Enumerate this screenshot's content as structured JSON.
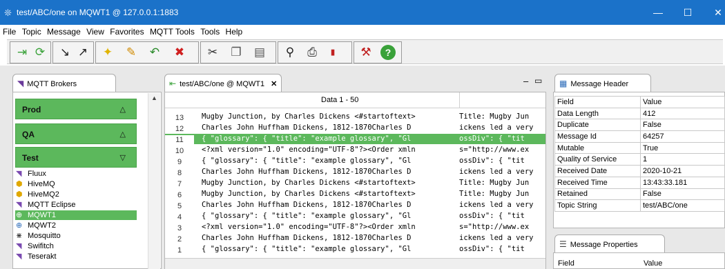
{
  "window": {
    "title": "test/ABC/one on MQWT1 @ 127.0.0.1:1883",
    "minimize": "—",
    "maximize": "☐",
    "close": "✕"
  },
  "menu": [
    "File",
    "Topic",
    "Message",
    "View",
    "Favorites",
    "MQTT Tools",
    "Tools",
    "Help"
  ],
  "toolbar": {
    "icons": [
      "connect-icon",
      "refresh-icon",
      "subscribe-icon",
      "unsubscribe-icon",
      "new-icon",
      "edit-icon",
      "reply-icon",
      "delete-icon",
      "cut-icon",
      "copy-icon",
      "paste-icon",
      "find-icon",
      "print-icon",
      "pdf-icon",
      "tools-icon",
      "help-icon"
    ]
  },
  "brokers": {
    "tab_label": "MQTT Brokers",
    "groups": [
      {
        "name": "Prod",
        "state": "collapsed"
      },
      {
        "name": "QA",
        "state": "collapsed"
      },
      {
        "name": "Test",
        "state": "expanded"
      }
    ],
    "items": [
      "Fluux",
      "HiveMQ",
      "HiveMQ2",
      "MQTT Eclipse",
      "MQWT1",
      "MQWT2",
      "Mosquitto",
      "Swifitch",
      "Teserakt"
    ],
    "selected": "MQWT1"
  },
  "messages": {
    "tab_label": "test/ABC/one @ MQWT1",
    "header": "Data 1 - 50",
    "rows": [
      {
        "n": "13",
        "c1": "Mugby Junction, by Charles Dickens <#startoftext>",
        "c2": "Title:  Mugby Jun"
      },
      {
        "n": "12",
        "c1": "Charles John Huffham Dickens, 1812-1870Charles D",
        "c2": "ickens led a very"
      },
      {
        "n": "11",
        "c1": "{ \"glossary\":  { \"title\":  \"example glossary\", \"Gl",
        "c2": "ossDiv\":  { \"tit"
      },
      {
        "n": "10",
        "c1": "<?xml version=\"1.0\" encoding=\"UTF-8\"?><Order xmln",
        "c2": "s=\"http://www.ex"
      },
      {
        "n": "9",
        "c1": "{ \"glossary\":  { \"title\":  \"example glossary\", \"Gl",
        "c2": "ossDiv\":  { \"tit"
      },
      {
        "n": "8",
        "c1": "Charles John Huffham Dickens, 1812-1870Charles D",
        "c2": "ickens led a very"
      },
      {
        "n": "7",
        "c1": "Mugby Junction, by Charles Dickens <#startoftext>",
        "c2": "Title:  Mugby Jun"
      },
      {
        "n": "6",
        "c1": "Mugby Junction, by Charles Dickens <#startoftext>",
        "c2": "Title:  Mugby Jun"
      },
      {
        "n": "5",
        "c1": "Charles John Huffham Dickens, 1812-1870Charles D",
        "c2": "ickens led a very"
      },
      {
        "n": "4",
        "c1": "{ \"glossary\":  { \"title\":  \"example glossary\", \"Gl",
        "c2": "ossDiv\":  { \"tit"
      },
      {
        "n": "3",
        "c1": "<?xml version=\"1.0\" encoding=\"UTF-8\"?><Order xmln",
        "c2": "s=\"http://www.ex"
      },
      {
        "n": "2",
        "c1": "Charles John Huffham Dickens, 1812-1870Charles D",
        "c2": "ickens led a very"
      },
      {
        "n": "1",
        "c1": "{ \"glossary\":  { \"title\":  \"example glossary\", \"Gl",
        "c2": "ossDiv\":  { \"tit"
      }
    ],
    "selected_row": "11"
  },
  "message_header": {
    "tab_label": "Message Header",
    "columns": [
      "Field",
      "Value"
    ],
    "rows": [
      [
        "Data Length",
        "412"
      ],
      [
        "Duplicate",
        "False"
      ],
      [
        "Message Id",
        "64257"
      ],
      [
        "Mutable",
        "True"
      ],
      [
        "Quality of Service",
        "1"
      ],
      [
        "Received Date",
        "2020-10-21"
      ],
      [
        "Received Time",
        "13:43:33.181"
      ],
      [
        "Retained",
        "False"
      ],
      [
        "Topic String",
        "test/ABC/one"
      ]
    ]
  },
  "message_properties": {
    "tab_label": "Message Properties",
    "columns": [
      "Field",
      "Value"
    ]
  },
  "colors": {
    "titlebar": "#1b72c9",
    "accent_green": "#5cb85c"
  }
}
